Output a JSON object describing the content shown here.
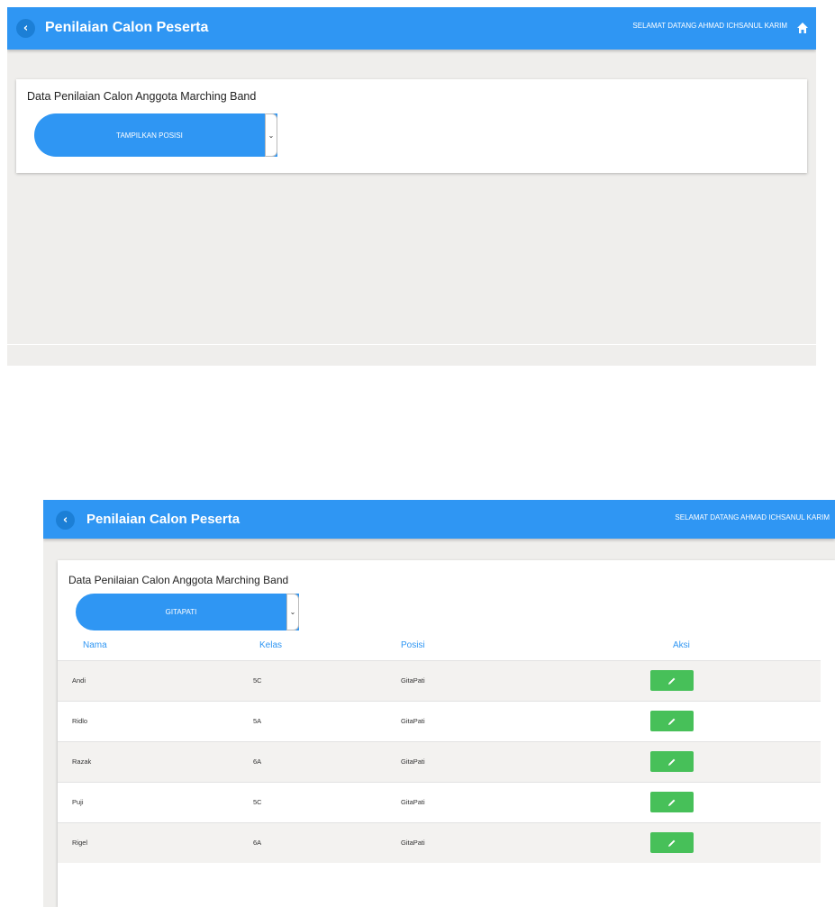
{
  "screen1": {
    "appbar": {
      "back": "‹",
      "title": "Penilaian Calon Peserta",
      "welcome": "SELAMAT DATANG AHMAD ICHSANUL KARIM"
    },
    "card": {
      "title": "Data Penilaian Calon Anggota Marching Band",
      "select_value": "TAMPILKAN POSISI"
    }
  },
  "screen2": {
    "appbar": {
      "back": "‹",
      "title": "Penilaian Calon Peserta",
      "welcome": "SELAMAT DATANG AHMAD ICHSANUL KARIM"
    },
    "card": {
      "title": "Data Penilaian Calon Anggota Marching Band",
      "select_value": "GITAPATI",
      "columns": [
        "Nama",
        "Kelas",
        "Posisi",
        "Aksi"
      ],
      "rows": [
        {
          "nama": "Andi",
          "kelas": "5C",
          "posisi": "GitaPati"
        },
        {
          "nama": "Ridlo",
          "kelas": "5A",
          "posisi": "GitaPati"
        },
        {
          "nama": "Razak",
          "kelas": "6A",
          "posisi": "GitaPati"
        },
        {
          "nama": "Puji",
          "kelas": "5C",
          "posisi": "GitaPati"
        },
        {
          "nama": "Rigel",
          "kelas": "6A",
          "posisi": "GitaPati"
        }
      ]
    }
  },
  "icons": {
    "home": "home-icon",
    "edit": "pencil-icon",
    "back": "chevron-left-icon",
    "dropdown": "chevron-down-icon"
  },
  "colors": {
    "primary": "#2f96f3",
    "success": "#47c059",
    "background": "#efeeec"
  }
}
